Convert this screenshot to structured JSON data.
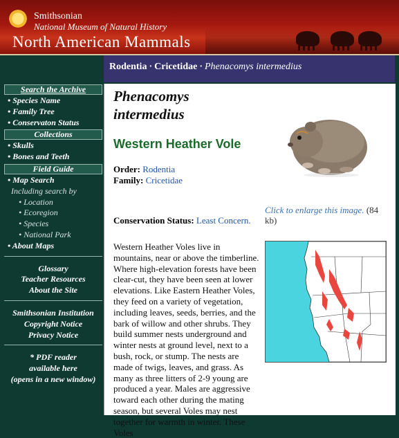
{
  "banner": {
    "institution": "Smithsonian",
    "museum": "National Museum of Natural History",
    "site_title": "North American Mammals"
  },
  "breadcrumb": {
    "order": "Rodentia",
    "family": "Cricetidae",
    "species": "Phenacomys intermedius",
    "separator": "·"
  },
  "sidebar": {
    "search_header": "Search the Archive",
    "search_links": [
      "• Species Name",
      "• Family Tree",
      "• Conservaton Status"
    ],
    "collections_header": "Collections",
    "collections_links": [
      "• Skulls",
      "• Bones and Teeth"
    ],
    "field_header": "Field Guide",
    "map_search": "• Map Search",
    "including": "Including search by",
    "field_sub": [
      "• Location",
      "• Ecoregion",
      "• Species",
      "• National Park"
    ],
    "about_maps": "• About Maps",
    "group1": [
      "Glossary",
      "Teacher Resources",
      "About the Site"
    ],
    "group2": [
      "Smithsonian Institution",
      "Copyright Notice",
      "Privacy Notice"
    ],
    "pdf": [
      "* PDF reader",
      "available here",
      "(opens in a new window)"
    ]
  },
  "species": {
    "scientific_line1": "Phenacomys",
    "scientific_line2": "intermedius",
    "common_name": "Western Heather Vole",
    "order_label": "Order:",
    "order_value": "Rodentia",
    "family_label": "Family:",
    "family_value": "Cricetidae",
    "conservation_label": "Conservation Status:",
    "conservation_value": "Least Concern.",
    "enlarge_link": "Click to enlarge this image.",
    "enlarge_size": "(84 kb)",
    "description": "Western Heather Voles live in mountains, near or above the timberline. Where high-elevation forests have been clear-cut, they have been seen at lower elevations. Like Eastern Heather Voles, they feed on a variety of vegetation, including leaves, seeds, berries, and the bark of willow and other shrubs. They build summer nests underground and winter nests at ground level, next to a bush, rock, or stump. The nests are made of twigs, leaves, and grass. As many as three litters of 2-9 young are produced a year. Males are aggressive toward each other during the mating season, but several Voles may nest together for warmth in winter. These Voles"
  },
  "colors": {
    "sidebar_bg": "#0f3a32",
    "breadcrumb_bg": "#36336e",
    "common_name": "#1a6b2a",
    "link": "#2255aa",
    "range": "#e8463e"
  }
}
